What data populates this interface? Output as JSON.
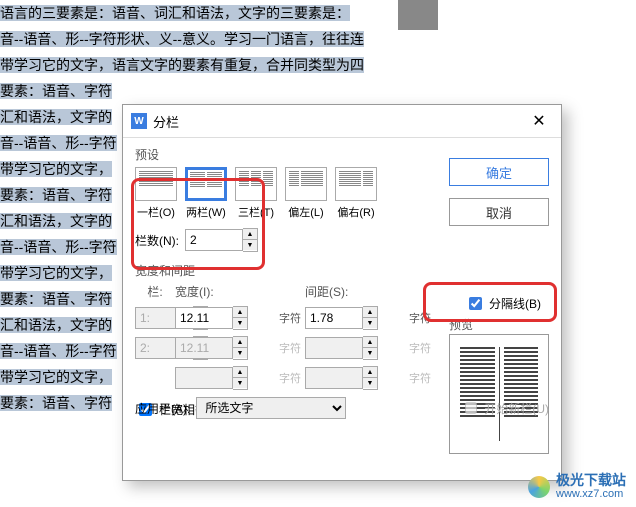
{
  "doc": {
    "lines": [
      "语言的三要素是：语音、词汇和语法，文字的三要素是：",
      "音--语音、形--字符形状、义--意义。学习一门语言，往往连",
      "带学习它的文字，语言文字的要素有重复，合并同类型为四",
      "要素：语音、字符",
      "汇和语法，文字的",
      "音--语音、形--字符",
      "带学习它的文字，",
      "要素：语音、字符",
      "汇和语法，文字的",
      "音--语音、形--字符",
      "带学习它的文字，",
      "要素：语音、字符",
      "汇和语法，文字的",
      "音--语音、形--字符",
      "带学习它的文字，",
      "要素：语音、字符"
    ]
  },
  "dialog": {
    "title": "分栏",
    "ok": "确定",
    "cancel": "取消",
    "preset_label": "预设",
    "presets": {
      "one": "一栏(O)",
      "two": "两栏(W)",
      "three": "三栏(T)",
      "left": "偏左(L)",
      "right": "偏右(R)"
    },
    "columns_label": "栏数(N):",
    "columns_value": "2",
    "separator_label": "分隔线(B)",
    "preview_label": "预览",
    "width_dist_label": "宽度和间距",
    "col_header": "栏:",
    "width_header": "宽度(I):",
    "spacing_header": "间距(S):",
    "row1_idx": "1:",
    "row1_width": "12.11",
    "row1_spacing": "1.78",
    "row2_idx": "2:",
    "row2_width": "12.11",
    "unit": "字符",
    "equal_width": "栏宽相等(E)",
    "apply_label": "应用于(A):",
    "apply_value": "所选文字",
    "newcol_label": "开始新栏(U)"
  },
  "footer": {
    "zh": "极光下载站",
    "en": "www.xz7.com"
  }
}
